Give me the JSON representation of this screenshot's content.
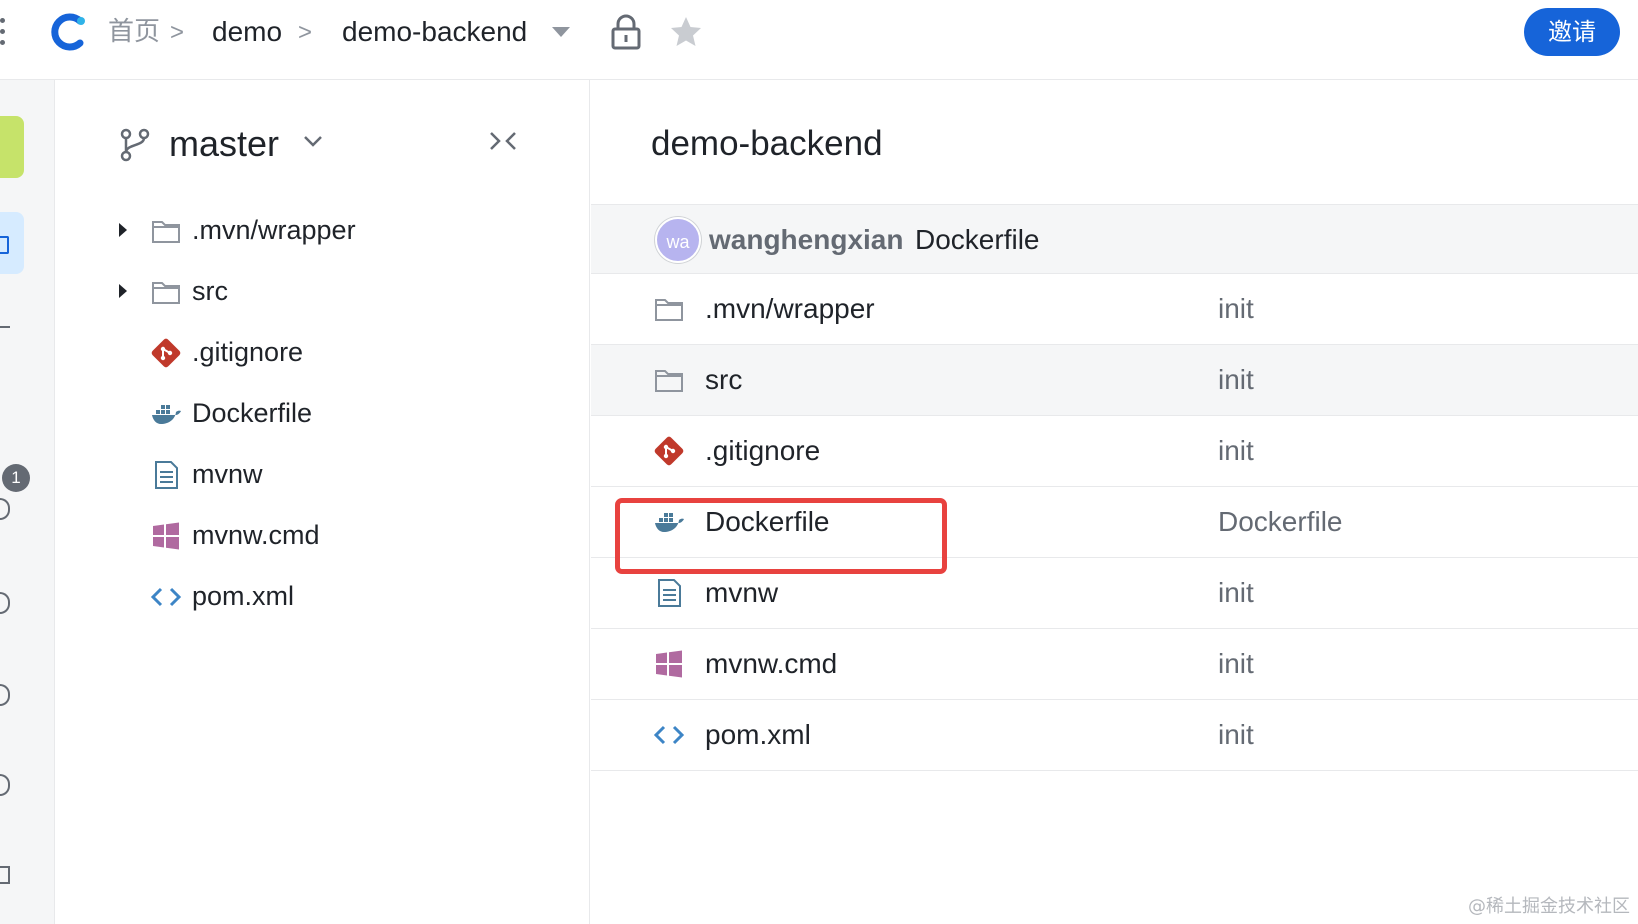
{
  "header": {
    "breadcrumb": {
      "home": "首页",
      "separator": ">",
      "project": "demo",
      "repo": "demo-backend"
    },
    "invite_label": "邀请",
    "accent_color": "#1664d9"
  },
  "leftnav": {
    "badge_count": "1"
  },
  "tree": {
    "branch": "master",
    "items": [
      {
        "name": ".mvn/wrapper",
        "type": "folder",
        "expandable": true
      },
      {
        "name": "src",
        "type": "folder",
        "expandable": true
      },
      {
        "name": ".gitignore",
        "type": "git-icon",
        "expandable": false
      },
      {
        "name": "Dockerfile",
        "type": "docker-icon",
        "expandable": false
      },
      {
        "name": "mvnw",
        "type": "text-file-icon",
        "expandable": false
      },
      {
        "name": "mvnw.cmd",
        "type": "windows-icon",
        "expandable": false
      },
      {
        "name": "pom.xml",
        "type": "code-icon",
        "expandable": false
      }
    ]
  },
  "main": {
    "title": "demo-backend",
    "latest_commit": {
      "avatar_text": "wa",
      "author": "wanghengxian",
      "message": "Dockerfile"
    },
    "files": [
      {
        "name": ".mvn/wrapper",
        "commit": "init",
        "icon": "folder-icon"
      },
      {
        "name": "src",
        "commit": "init",
        "icon": "folder-icon"
      },
      {
        "name": ".gitignore",
        "commit": "init",
        "icon": "git-icon"
      },
      {
        "name": "Dockerfile",
        "commit": "Dockerfile",
        "icon": "docker-icon",
        "highlighted": true
      },
      {
        "name": "mvnw",
        "commit": "init",
        "icon": "text-file-icon"
      },
      {
        "name": "mvnw.cmd",
        "commit": "init",
        "icon": "windows-icon"
      },
      {
        "name": "pom.xml",
        "commit": "init",
        "icon": "code-icon"
      }
    ],
    "highlight_color": "#e8423f"
  },
  "watermark": "@稀土掘金技术社区"
}
